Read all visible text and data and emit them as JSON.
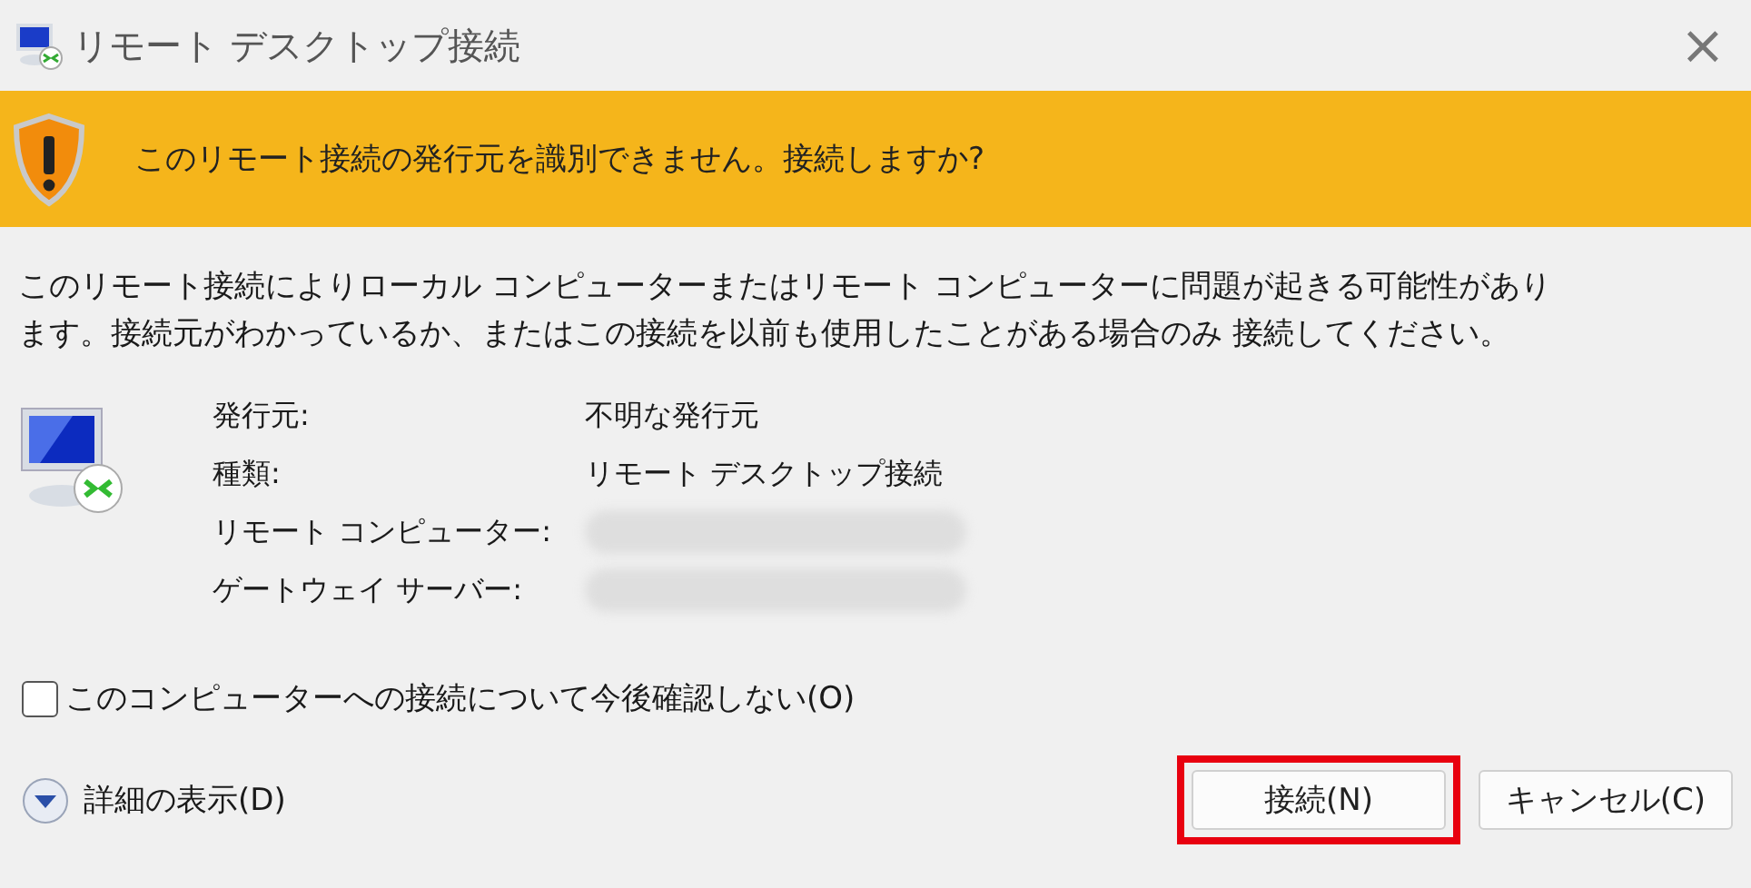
{
  "window": {
    "title": "リモート デスクトップ接続",
    "close": "×"
  },
  "banner": {
    "text": "このリモート接続の発行元を識別できません。接続しますか?"
  },
  "message": "このリモート接続によりローカル コンピューターまたはリモート コンピューターに問題が起きる可能性があります。接続元がわかっているか、またはこの接続を以前も使用したことがある場合のみ 接続してください。",
  "details": [
    {
      "label": "発行元:",
      "value": "不明な発行元",
      "redacted": false
    },
    {
      "label": "種類:",
      "value": "リモート デスクトップ接続",
      "redacted": false
    },
    {
      "label": "リモート コンピューター:",
      "redacted": true
    },
    {
      "label": "ゲートウェイ サーバー:",
      "redacted": true
    }
  ],
  "dont_ask": {
    "label": "このコンピューターへの接続について今後確認しない(O)",
    "checked": false
  },
  "more_details": {
    "label": "詳細の表示(D)",
    "expanded": false
  },
  "buttons": [
    {
      "label": "接続(N)",
      "highlighted": true
    },
    {
      "label": "キャンセル(C)",
      "highlighted": false
    }
  ]
}
